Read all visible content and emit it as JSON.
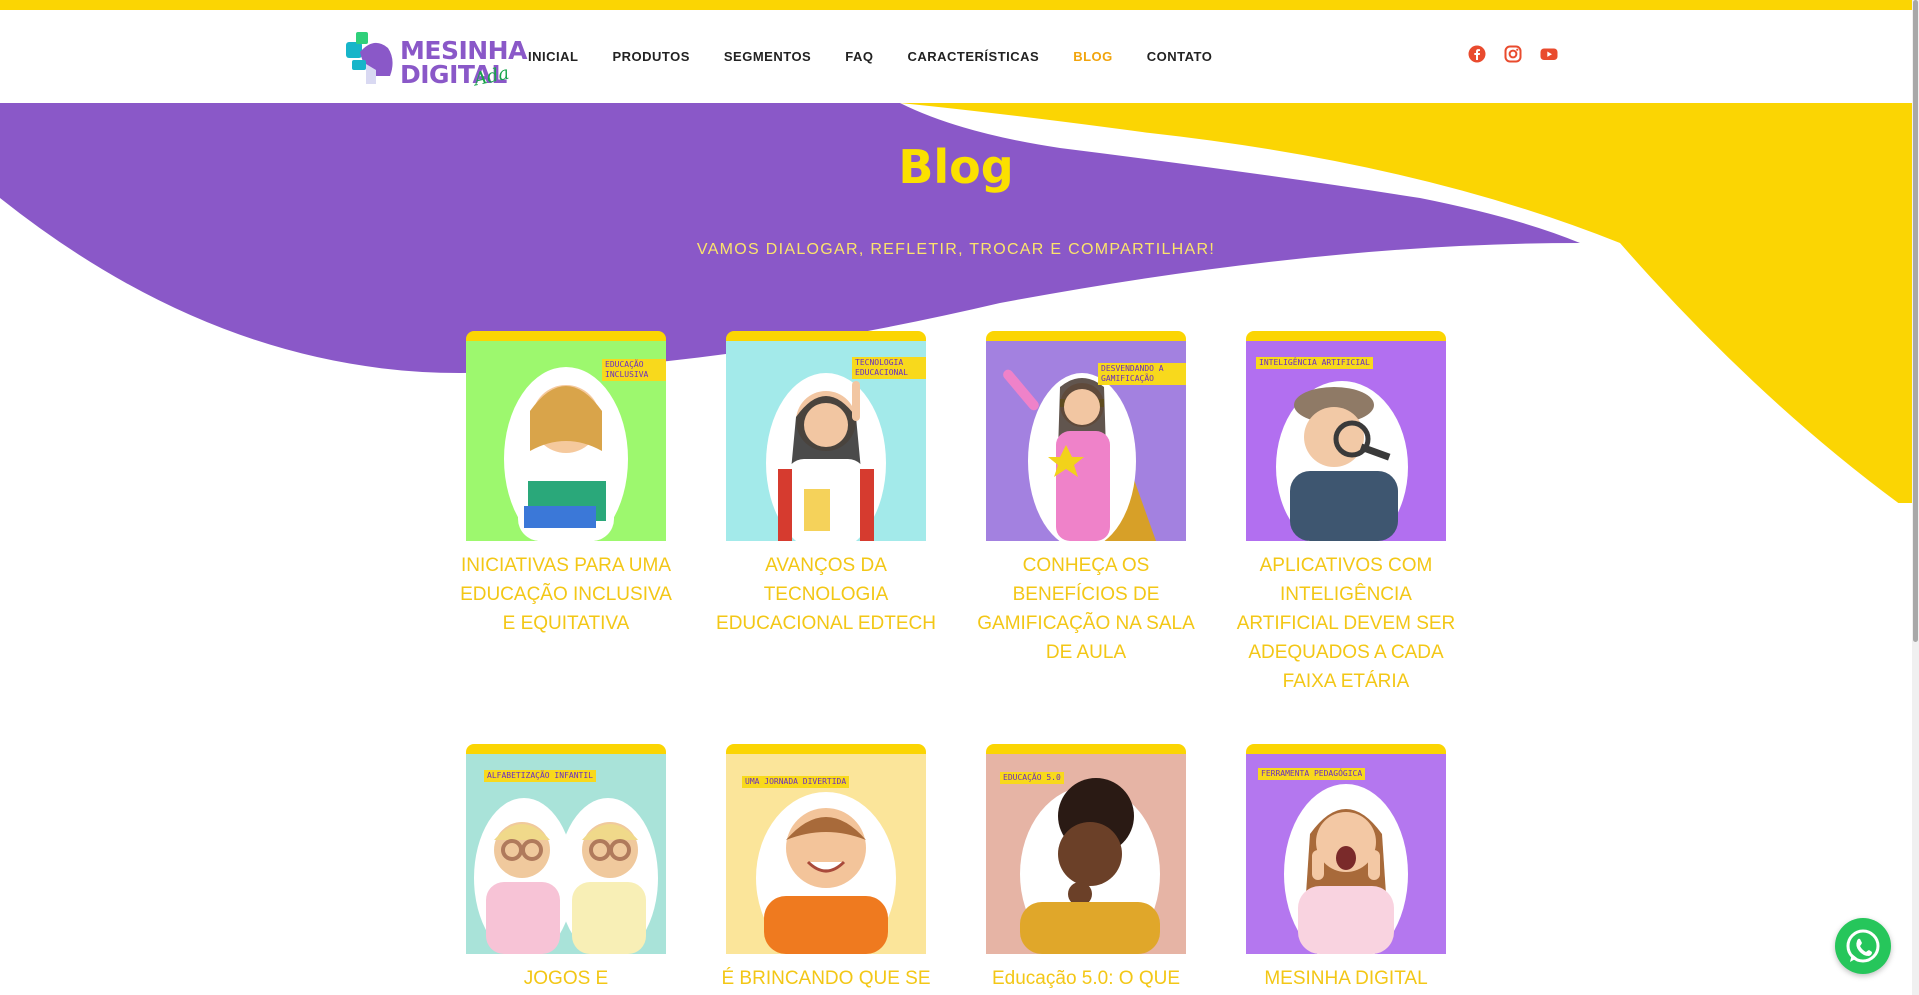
{
  "brand": {
    "name_line1": "MESINHA",
    "name_line2": "DIGITAL",
    "name_script": "Ada"
  },
  "nav": {
    "items": [
      {
        "label": "INICIAL"
      },
      {
        "label": "PRODUTOS"
      },
      {
        "label": "SEGMENTOS"
      },
      {
        "label": "FAQ"
      },
      {
        "label": "CARACTERÍSTICAS"
      },
      {
        "label": "BLOG",
        "active": true
      },
      {
        "label": "CONTATO"
      }
    ]
  },
  "social": [
    "facebook-icon",
    "instagram-icon",
    "youtube-icon"
  ],
  "hero": {
    "title": "Blog",
    "tagline": "VAMOS DIALOGAR, REFLETIR, TROCAR E COMPARTILHAR!"
  },
  "colors": {
    "purple": "#8a58c8",
    "yellow": "#fbd503",
    "title_yellow": "#f3c716",
    "nav_active": "#f1a40c"
  },
  "posts": [
    {
      "title": "INICIATIVAS PARA UMA EDUCAÇÃO INCLUSIVA E EQUITATIVA",
      "badge": "EDUCAÇÃO INCLUSIVA",
      "bg": "#9df86e"
    },
    {
      "title": "AVANÇOS DA TECNOLOGIA EDUCACIONAL EDTECH",
      "badge": "TECNOLOGIA EDUCACIONAL",
      "bg": "#a3eaea"
    },
    {
      "title": "CONHEÇA OS BENEFÍCIOS DE GAMIFICAÇÃO NA SALA DE AULA",
      "badge": "DESVENDANDO A GAMIFICAÇÃO",
      "bg": "#a381e0"
    },
    {
      "title": "APLICATIVOS COM INTELIGÊNCIA ARTIFICIAL DEVEM SER ADEQUADOS A CADA FAIXA ETÁRIA",
      "badge": "INTELIGÊNCIA ARTIFICIAL",
      "bg": "#b26ff0"
    },
    {
      "title": "JOGOS E",
      "badge": "ALFABETIZAÇÃO INFANTIL",
      "bg": "#a9e3d9"
    },
    {
      "title": "É BRINCANDO QUE SE",
      "badge": "UMA JORNADA DIVERTIDA",
      "bg": "#fbe59a"
    },
    {
      "title": "Educação 5.0: O QUE",
      "badge": "EDUCAÇÃO 5.0",
      "bg": "#e6b4a5"
    },
    {
      "title": "MESINHA DIGITAL",
      "badge": "FERRAMENTA PEDAGÓGICA",
      "bg": "#b477ef"
    }
  ]
}
